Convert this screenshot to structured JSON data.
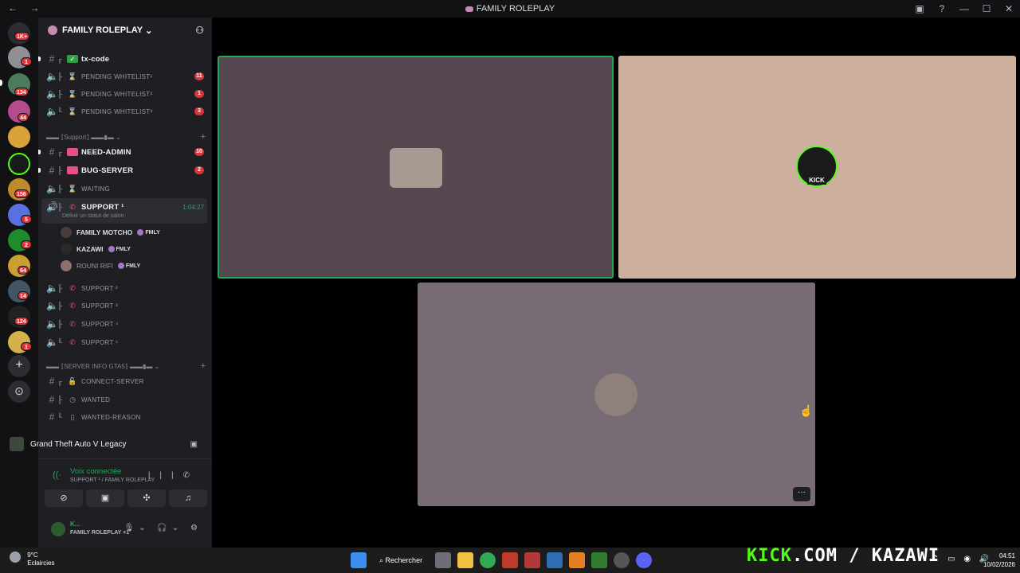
{
  "window": {
    "title": "FAMILY ROLEPLAY",
    "nav": "← →"
  },
  "window_controls": {
    "icons": [
      "screen-share-icon",
      "help-icon"
    ],
    "minimize": "—",
    "maximize": "☐",
    "close": "✕"
  },
  "servers": [
    {
      "name": "home",
      "badge": "1K+",
      "color": "#5865f2"
    },
    {
      "name": "server-2",
      "badge": "1",
      "color": "#8d8f94"
    },
    {
      "name": "server-3",
      "badge": "134",
      "color": "#4b7b5a"
    },
    {
      "name": "server-4",
      "badge": "44",
      "color": "#b44b8b"
    },
    {
      "name": "server-5",
      "badge": "",
      "color": "#d9a13a"
    },
    {
      "name": "kick-server",
      "badge": "",
      "color": "#1a1a1a"
    },
    {
      "name": "server-7",
      "badge": "156",
      "color": "#c08a2a"
    },
    {
      "name": "server-8",
      "badge": "5",
      "color": "#5a6fe0"
    },
    {
      "name": "server-9",
      "badge": "2",
      "color": "#1d8c2a"
    },
    {
      "name": "server-10",
      "badge": "64",
      "color": "#caa030"
    },
    {
      "name": "server-11",
      "badge": "14",
      "color": "#445566"
    },
    {
      "name": "server-12",
      "badge": "124",
      "color": "#222222"
    },
    {
      "name": "server-13",
      "badge": "1",
      "color": "#d6b14a"
    }
  ],
  "server_actions": {
    "add": "+",
    "discover": "⊙"
  },
  "server_header": {
    "name": "FAMILY ROLEPLAY",
    "chevron": "⌄",
    "invite_icon": "⚇"
  },
  "channels": {
    "tx_code": "tx-code",
    "pending1": "PENDING WHITELIST¹",
    "pending1_badge": "11",
    "pending2": "PENDING WHITELIST²",
    "pending2_badge": "1",
    "pending3": "PENDING WHITELIST³",
    "pending3_badge": "3",
    "support_category": "▬▬ ⟦Support⟧ ▬▬▮▬ ⌄",
    "need_admin": "NEED-ADMIN",
    "need_admin_badge": "10",
    "bug_server": "BUG-SERVER",
    "bug_server_badge": "2",
    "waiting": "WAITING",
    "support1": "SUPPORT ¹",
    "support1_timer": "1:04:27",
    "support1_status": "Définir un statut de salon",
    "support2": "SUPPORT ²",
    "support3": "SUPPORT ³",
    "support4": "SUPPORT ⁴",
    "support5": "SUPPORT ⁵",
    "info_category": "▬▬ ⟦SERVER INFO GTA5⟧ ▬▬▮▬ ⌄",
    "connect_server": "CONNECT-SERVER",
    "wanted": "WANTED",
    "wanted_reason": "WANTED-REASON",
    "plus": "+"
  },
  "voice_users": [
    {
      "name": "FAMILY MOTCHO",
      "tag": "FMLY"
    },
    {
      "name": "KAZAWI",
      "tag": "FMLY"
    },
    {
      "name": "ROUNI RIFI",
      "tag": "FMLY"
    }
  ],
  "activity": {
    "game": "Grand Theft Auto V Legacy"
  },
  "voice": {
    "status": "Voix connectée",
    "channel": "SUPPORT ¹ / FAMILY ROLEPLAY"
  },
  "voice_buttons": [
    "camera-off-icon",
    "screen-share-icon",
    "activities-icon",
    "soundboard-icon"
  ],
  "user_panel": {
    "name": "K...",
    "sub": "FAMILY ROLEPLAY +1"
  },
  "tiles": [
    {
      "name": "tile-1",
      "bg": "#554850",
      "speaking": true
    },
    {
      "name": "tile-2",
      "bg": "#ccb09d",
      "speaking": false,
      "label": "KICK"
    },
    {
      "name": "tile-3",
      "bg": "#776b75",
      "speaking": false
    }
  ],
  "more_label": "···",
  "taskbar": {
    "temp": "9°C",
    "weather": "Eclaircies",
    "search": "Rechercher",
    "kick_brand": "KICK",
    "kick_rest": ".COM / KAZAWI",
    "time": "04:51",
    "date": "10/02/2026"
  },
  "colors": {
    "accent_green": "#23a55a",
    "badge_red": "#da373c",
    "kick_green": "#53fc18"
  }
}
